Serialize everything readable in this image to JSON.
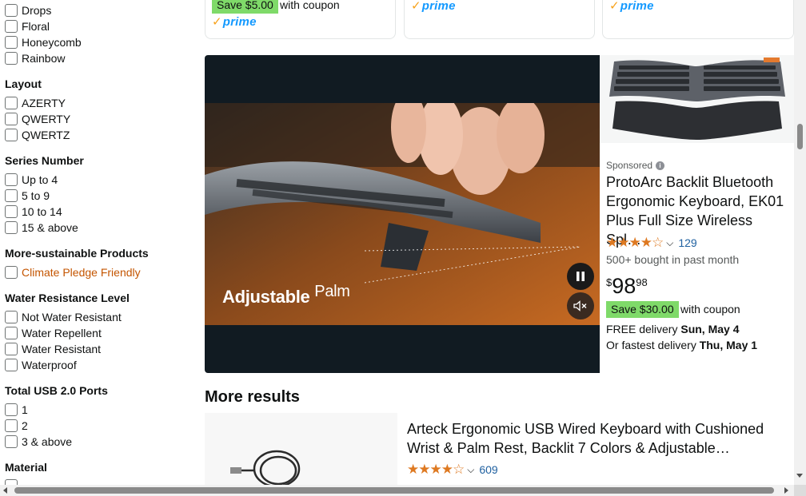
{
  "sidebar": {
    "pattern_items": [
      "Drops",
      "Floral",
      "Honeycomb",
      "Rainbow"
    ],
    "layout": {
      "heading": "Layout",
      "items": [
        "AZERTY",
        "QWERTY",
        "QWERTZ"
      ]
    },
    "series": {
      "heading": "Series Number",
      "items": [
        "Up to 4",
        "5 to 9",
        "10 to 14",
        "15 & above"
      ]
    },
    "sustainable": {
      "heading": "More-sustainable Products",
      "items": [
        "Climate Pledge Friendly"
      ]
    },
    "water": {
      "heading": "Water Resistance Level",
      "items": [
        "Not Water Resistant",
        "Water Repellent",
        "Water Resistant",
        "Waterproof"
      ]
    },
    "usb": {
      "heading": "Total USB 2.0 Ports",
      "items": [
        "1",
        "2",
        "3 & above"
      ]
    },
    "material": {
      "heading": "Material"
    }
  },
  "top_cards": {
    "save_label": "Save $5.00",
    "coupon_text": "with coupon",
    "prime_label": "prime"
  },
  "sponsored": {
    "video_caption": "Adjustable",
    "video_caption_2": "Palm",
    "label": "Sponsored",
    "title": "ProtoArc Backlit Bluetooth Ergonomic Keyboard, EK01 Plus Full Size Wireless Spl…",
    "stars": "★★★★☆",
    "rating_count": "129",
    "bought": "500+ bought in past month",
    "price_symbol": "$",
    "price_whole": "98",
    "price_fraction": "98",
    "save_label": "Save $30.00",
    "coupon_text": "with coupon",
    "delivery_prefix": "FREE delivery ",
    "delivery_date": "Sun, May 4",
    "fastest_prefix": "Or fastest delivery ",
    "fastest_date": "Thu, May 1",
    "accent": "#de7921",
    "save_badge_color": "#7fda69"
  },
  "more_results": {
    "heading": "More results",
    "first": {
      "title": "Arteck Ergonomic USB Wired Keyboard with Cushioned Wrist & Palm Rest, Backlit 7 Colors & Adjustable…",
      "stars": "★★★★☆",
      "rating_count": "609"
    }
  }
}
